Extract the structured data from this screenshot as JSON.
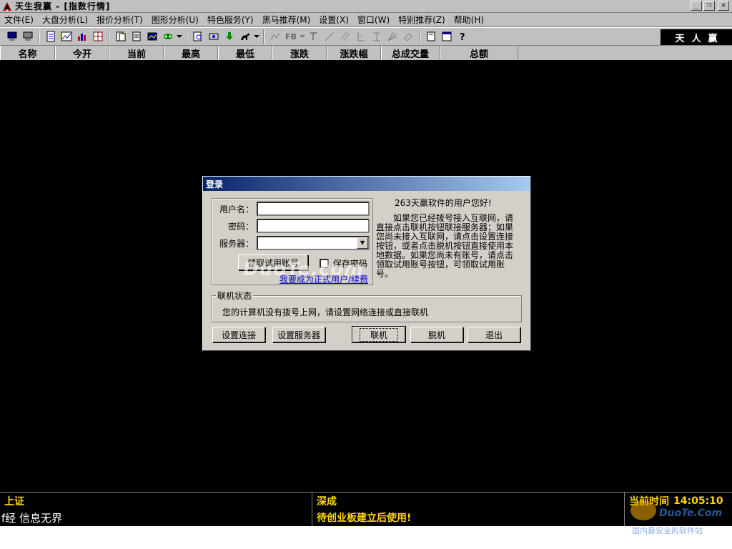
{
  "window": {
    "title": "天生我赢 - [指数行情]",
    "minimize_glyph": "_",
    "restore_glyph": "❐",
    "close_glyph": "✕"
  },
  "menu": {
    "items": [
      {
        "label": "文件(E)"
      },
      {
        "label": "大盘分析(L)"
      },
      {
        "label": "报价分析(T)"
      },
      {
        "label": "图形分析(U)"
      },
      {
        "label": "特色服务(Y)"
      },
      {
        "label": "黑马推荐(M)"
      },
      {
        "label": "设置(X)"
      },
      {
        "label": "窗口(W)"
      },
      {
        "label": "特别推荐(Z)"
      },
      {
        "label": "帮助(H)"
      }
    ]
  },
  "toolbar": {
    "fb_label": "FB",
    "logo_chars": [
      "天",
      "人",
      "赢"
    ]
  },
  "columns": [
    "名称",
    "今开",
    "当前",
    "最高",
    "最低",
    "涨跌",
    "涨跌幅",
    "总成交量",
    "总额"
  ],
  "status": {
    "shanghai": "上证",
    "shenzhen": "深成",
    "time_label": "当前时间",
    "time_value": "14:05:10",
    "ticker": "f经 信息无界",
    "gem_notice": "待创业板建立后使用!"
  },
  "watermark": {
    "site": "DuoTe.Com",
    "tagline": "国内最安全的软件站",
    "dialog_mark": "DuoTe.com"
  },
  "dialog": {
    "title": "登录",
    "username_label": "用户名：",
    "password_label": "密码：",
    "server_label": "服务器：",
    "username_value": "",
    "password_value": "",
    "server_value": "",
    "trial_button": "领取试用账号",
    "save_password_label": "保存密码",
    "upgrade_link": "我要成为正式用户/续费",
    "greeting": "263天赢软件的用户您好!",
    "description": "如果您已经拨号接入互联网，请直接点击联机按钮联接服务器；如果您尚未接入互联网，请点击设置连接按钮，或者点击脱机按钮直接使用本地数据。如果您尚未有账号，请点击领取试用账号按钮，可领取试用账号。",
    "status_group_title": "联机状态",
    "status_message": "您的计算机没有拨号上网，请设置网络连接或直接联机",
    "buttons": {
      "setup_connection": "设置连接",
      "setup_server": "设置服务器",
      "connect": "联机",
      "offline": "脱机",
      "exit": "退出"
    }
  }
}
